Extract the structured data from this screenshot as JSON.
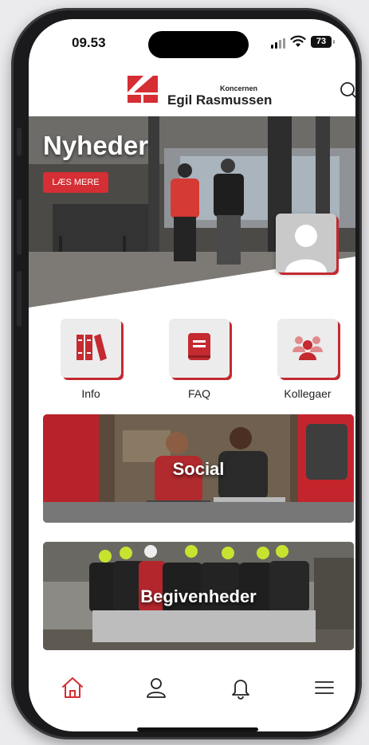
{
  "status_bar": {
    "time": "09.53",
    "battery": "73"
  },
  "header": {
    "logo_small": "Koncernen",
    "logo_name": "Egil Rasmussen",
    "search_icon": "search-icon"
  },
  "hero": {
    "title": "Nyheder",
    "button": "LÆS MERE",
    "avatar_icon": "user-placeholder-icon"
  },
  "quick_links": [
    {
      "label": "Info",
      "icon": "books-icon"
    },
    {
      "label": "FAQ",
      "icon": "book-icon"
    },
    {
      "label": "Kollegaer",
      "icon": "people-icon"
    }
  ],
  "banners": [
    {
      "label": "Social"
    },
    {
      "label": "Begivenheder"
    }
  ],
  "bottom_nav": [
    {
      "icon": "home-icon",
      "active": true
    },
    {
      "icon": "profile-icon",
      "active": false
    },
    {
      "icon": "bell-icon",
      "active": false
    },
    {
      "icon": "menu-icon",
      "active": false
    }
  ],
  "colors": {
    "accent": "#d52e34",
    "text": "#222222",
    "tile_bg": "#ececec"
  }
}
